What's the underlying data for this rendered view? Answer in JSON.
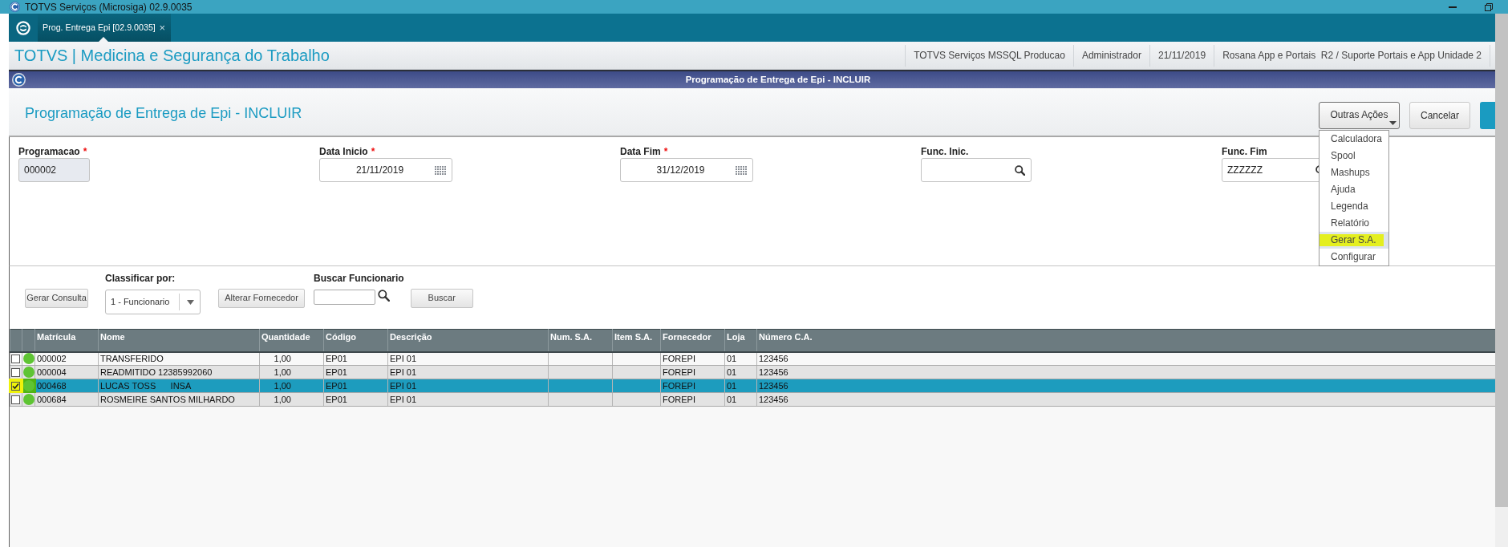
{
  "window": {
    "title": "TOTVS Serviços (Microsiga) 02.9.0035"
  },
  "tabs": [
    {
      "label": "Prog. Entrega Epi [02.9.0035]",
      "close": "×",
      "selected": true
    }
  ],
  "app_header": {
    "title": "TOTVS | Medicina e Segurança do Trabalho",
    "info": [
      "TOTVS Serviços MSSQL Producao",
      "Administrador",
      "21/11/2019",
      "Rosana App e Portais  R2 / Suporte Portais e App Unidade 2"
    ]
  },
  "dialog": {
    "title": "Programação de Entrega de Epi - INCLUIR"
  },
  "page": {
    "title": "Programação de Entrega de Epi - INCLUIR",
    "buttons": [
      {
        "kind": "dropdown",
        "label": "Outras Ações",
        "expanded": true
      },
      {
        "kind": "secondary",
        "label": "Cancelar"
      },
      {
        "kind": "primary"
      }
    ]
  },
  "menu": {
    "items": [
      {
        "label": "Calculadora",
        "selected": false,
        "highlighted": false
      },
      {
        "label": "Spool",
        "selected": false,
        "highlighted": false
      },
      {
        "label": "Mashups",
        "selected": false,
        "highlighted": false
      },
      {
        "label": "Ajuda",
        "selected": false,
        "highlighted": false
      },
      {
        "label": "Legenda",
        "selected": false,
        "highlighted": false
      },
      {
        "label": "Relatório",
        "selected": false,
        "highlighted": false
      },
      {
        "label": "Gerar S.A.",
        "selected": true,
        "highlighted": true
      },
      {
        "label": "Configurar",
        "selected": false,
        "highlighted": false
      }
    ]
  },
  "fields": [
    {
      "kind": "text",
      "label": "Programacao",
      "required_mark": "*",
      "value": "000002",
      "disabled": true
    },
    {
      "kind": "date",
      "label": "Data Inicio",
      "required_mark": "*",
      "value": "21/11/2019",
      "disabled": false
    },
    {
      "kind": "date",
      "label": "Data Fim",
      "required_mark": "*",
      "value": "31/12/2019",
      "disabled": false
    },
    {
      "kind": "lookup",
      "label": "Func. Inic.",
      "disabled": false
    },
    {
      "kind": "lookup",
      "label": "Func. Fim",
      "value": "ZZZZZZ",
      "disabled": false
    }
  ],
  "filters": [
    {
      "kind": "button",
      "label": "Gerar Consulta"
    },
    {
      "kind": "select",
      "label": "Classificar por:",
      "value": "1 - Funcionario"
    },
    {
      "kind": "button",
      "label": "Alterar Fornecedor"
    },
    {
      "kind": "search",
      "label": "Buscar Funcionario"
    },
    {
      "kind": "button",
      "label": "Buscar"
    }
  ],
  "table": {
    "columns": [
      "Matrícula",
      "Nome",
      "Quantidade",
      "Código",
      "Descrição",
      "Num. S.A.",
      "Item S.A.",
      "Fornecedor",
      "Loja",
      "Número C.A."
    ],
    "rows": [
      {
        "checked": false,
        "selected": false,
        "highlighted": false,
        "color": "#5ec433",
        "cells": [
          "000002",
          "TRANSFERIDO",
          "1,00",
          "EP01",
          "EPI 01",
          null,
          null,
          "FOREPI",
          "01",
          "123456"
        ]
      },
      {
        "checked": false,
        "selected": false,
        "highlighted": false,
        "color": "#5ec433",
        "cells": [
          "000004",
          "READMITIDO 12385992060",
          "1,00",
          "EP01",
          "EPI 01",
          null,
          null,
          "FOREPI",
          "01",
          "123456"
        ]
      },
      {
        "checked": true,
        "selected": true,
        "highlighted": true,
        "color": "#5ec433",
        "cells": [
          "000468",
          "LUCAS TOSS      INSA",
          "1,00",
          "EP01",
          "EPI 01",
          null,
          null,
          "FOREPI",
          "01",
          "123456"
        ]
      },
      {
        "checked": false,
        "selected": false,
        "highlighted": false,
        "color": "#5ec433",
        "cells": [
          "000684",
          "ROSMEIRE SANTOS MILHARDO",
          "1,00",
          "EP01",
          "EPI 01",
          null,
          null,
          "FOREPI",
          "01",
          "123456"
        ]
      }
    ]
  }
}
